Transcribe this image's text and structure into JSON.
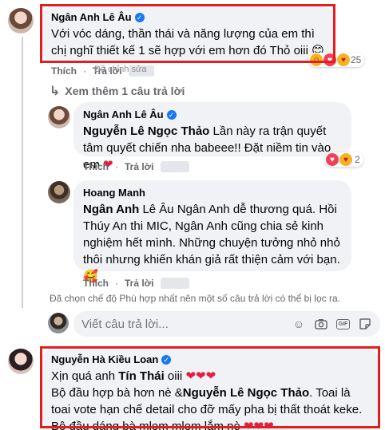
{
  "c1": {
    "author": "Ngân Anh Lê Âu",
    "text": "Với vóc dáng, thần thái và năng lượng của em thì chị nghĩ thiết kế 1 sẽ hợp với em hơn đó Thỏ oiii 😊",
    "like": "Thích",
    "reply": "Trả lời",
    "edited": "Đã chỉnh sửa",
    "reaction_count": "25"
  },
  "see_more": "Xem thêm 1 câu trả lời",
  "r1": {
    "author": "Ngân Anh Lê Âu",
    "mention": "Nguyễn Lê Ngọc Thảo",
    "text": " Lần này ra trận quyết tâm quyết chiến nha babeee!! Đặt niềm tin vào em ",
    "heart": "❤",
    "like": "Thích",
    "reply": "Trả lời",
    "reaction_count": "2"
  },
  "r2": {
    "author": "Hoang Manh",
    "mention": "Ngân Anh",
    "text": " Lê Âu Ngân Anh dễ thương quá. Hồi Thúy An thi MIC, Ngân Anh cũng chia sẻ kinh nghiệm hết mình. Những chuyện tưởng nhỏ nhỏ thôi nhưng khiến khán giả rất thiện cảm với bạn.",
    "emoji": "🥰",
    "like": "Thích",
    "reply": "Trả lời"
  },
  "filter_note": "Đã chọn chế độ Phù hợp nhất nên một số câu trả lời có thể bị lọc ra.",
  "input": {
    "placeholder": "Viết câu trả lời..."
  },
  "c2": {
    "author": "Nguyễn Hà Kiều Loan",
    "line1_pre": "Xịn quá anh ",
    "line1_mention": "Tín Thái",
    "line1_post": " oiii ",
    "line1_hearts": "❤❤❤",
    "line2_pre": "Bộ đầu hợp bà hơn nè &",
    "line2_mention": "Nguyễn Lê Ngọc Thảo",
    "line2_post": ". Toai là toai vote hạn chế detail cho đỡ mấy pha bị thất thoát keke. Bộ đầu dáng bà mlem mlem lắm nè ",
    "line2_hearts": "❤❤❤"
  },
  "colors": {
    "highlight_box": "#e0201f",
    "verified": "#1877f2",
    "bubble": "#f0f2f5"
  }
}
